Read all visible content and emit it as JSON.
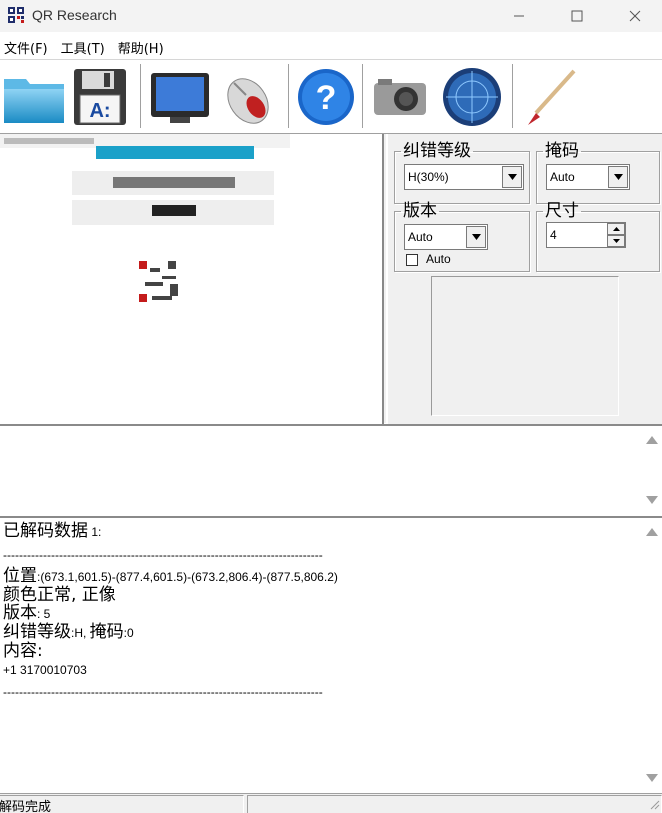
{
  "window": {
    "title": "QR Research"
  },
  "menu": [
    {
      "label": "文件(F)"
    },
    {
      "label": "工具(T)"
    },
    {
      "label": "帮助(H)"
    }
  ],
  "toolbar": {
    "tools": [
      "folder-icon",
      "save-icon",
      "monitor-icon",
      "mouse-icon",
      "help-icon",
      "camera-icon",
      "radar-icon",
      "brush-icon"
    ]
  },
  "settings": {
    "error_level": {
      "legend": "纠错等级",
      "value": "H(30%)"
    },
    "mask": {
      "legend": "掩码",
      "value": "Auto"
    },
    "version": {
      "legend": "版本",
      "value": "Auto",
      "auto_label": "Auto"
    },
    "size": {
      "legend": "尺寸",
      "value": "4"
    }
  },
  "output": {
    "title_label": "已解码数据",
    "title_index": " 1:",
    "divider": "--------------------------------------------------------------------------------",
    "position_label": "位置",
    "position_value": ":(673.1,601.5)-(877.4,601.5)-(673.2,806.4)-(877.5,806.2)",
    "color_status": "颜色正常, 正像",
    "version_label": "版本",
    "version_value": ": 5",
    "ec_label": "纠错等级",
    "ec_value": ":H, ",
    "mask_label": "掩码",
    "mask_value": ":0",
    "content_label": "内容:",
    "content_value": "+1 3170010703",
    "divider2": "--------------------------------------------------------------------------------"
  },
  "status": {
    "text": "解码完成"
  },
  "colors": {
    "accent": "#1ba1c9",
    "titlebar": "#f3f3f3",
    "panel": "#f0f0f0"
  }
}
